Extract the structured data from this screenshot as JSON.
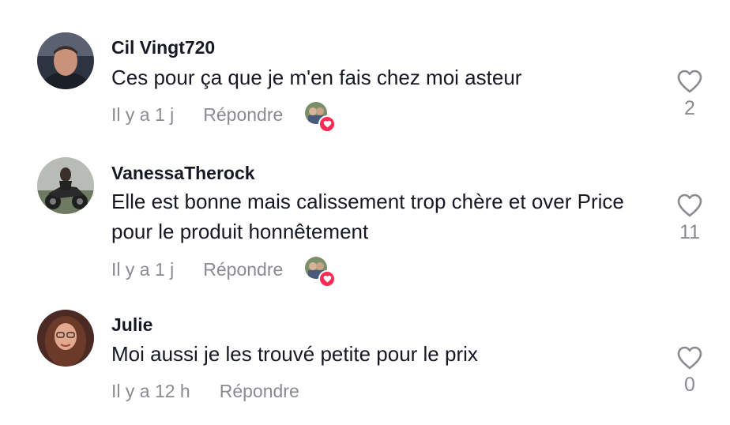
{
  "comments": [
    {
      "username": "Cil Vingt720",
      "text": "Ces pour ça que je m'en fais chez moi asteur",
      "time": "Il y a 1 j",
      "reply_label": "Répondre",
      "creator_liked": true,
      "like_count": "2"
    },
    {
      "username": "VanessaTherock",
      "text": "Elle est bonne mais calissement trop chère et over Price pour le produit honnêtement",
      "time": "Il y a 1 j",
      "reply_label": "Répondre",
      "creator_liked": true,
      "like_count": "11"
    },
    {
      "username": "Julie",
      "text": "Moi aussi je les trouvé petite pour le prix",
      "time": "Il y a 12 h",
      "reply_label": "Répondre",
      "creator_liked": false,
      "like_count": "0"
    }
  ],
  "colors": {
    "text_primary": "#161823",
    "text_secondary": "#8a8b91",
    "creator_heart": "#fe2c55"
  },
  "icons": {
    "like": "heart-outline-icon",
    "creator_like_badge": "heart-filled-icon"
  }
}
